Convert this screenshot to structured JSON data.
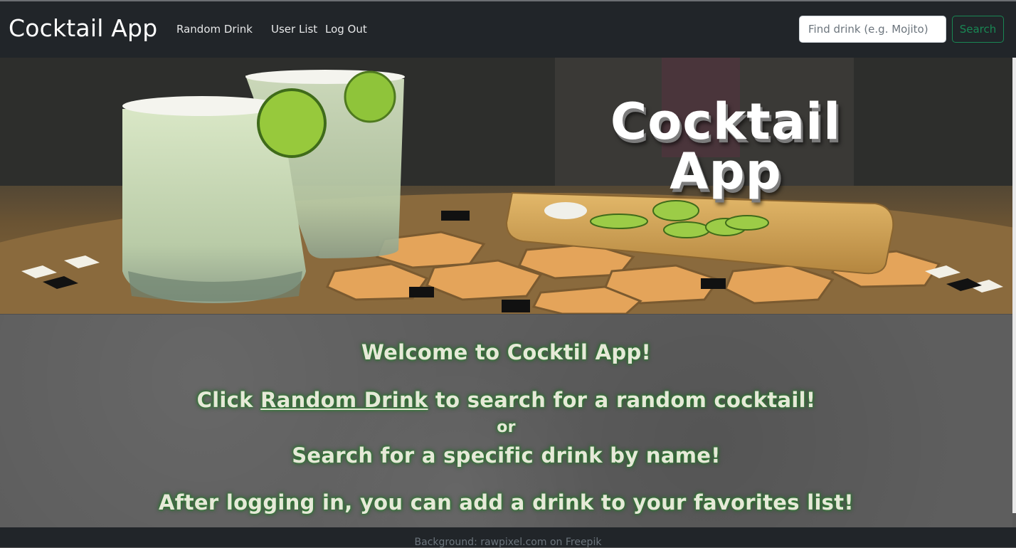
{
  "navbar": {
    "brand": "Cocktail App",
    "links": [
      {
        "label": "Random Drink"
      },
      {
        "label": "User List"
      },
      {
        "label": "Log Out"
      }
    ],
    "search": {
      "placeholder": "Find drink (e.g. Mojito)",
      "value": "",
      "button_label": "Search"
    }
  },
  "hero": {
    "title_line1": "Cocktail",
    "title_line2": "App"
  },
  "welcome": {
    "heading": "Welcome to Cocktil App!",
    "line1_prefix": "Click ",
    "line1_link": "Random Drink",
    "line1_suffix": " to search for a random cocktail!",
    "or": "or",
    "line2": "Search for a specific drink by name!",
    "line3": "After logging in, you can add a drink to your favorites list!"
  },
  "footer": {
    "credit": "Background: rawpixel.com on Freepik"
  },
  "colors": {
    "navbar": "#212529",
    "search_accent": "#198754",
    "text_glow": "#2e7d32"
  }
}
